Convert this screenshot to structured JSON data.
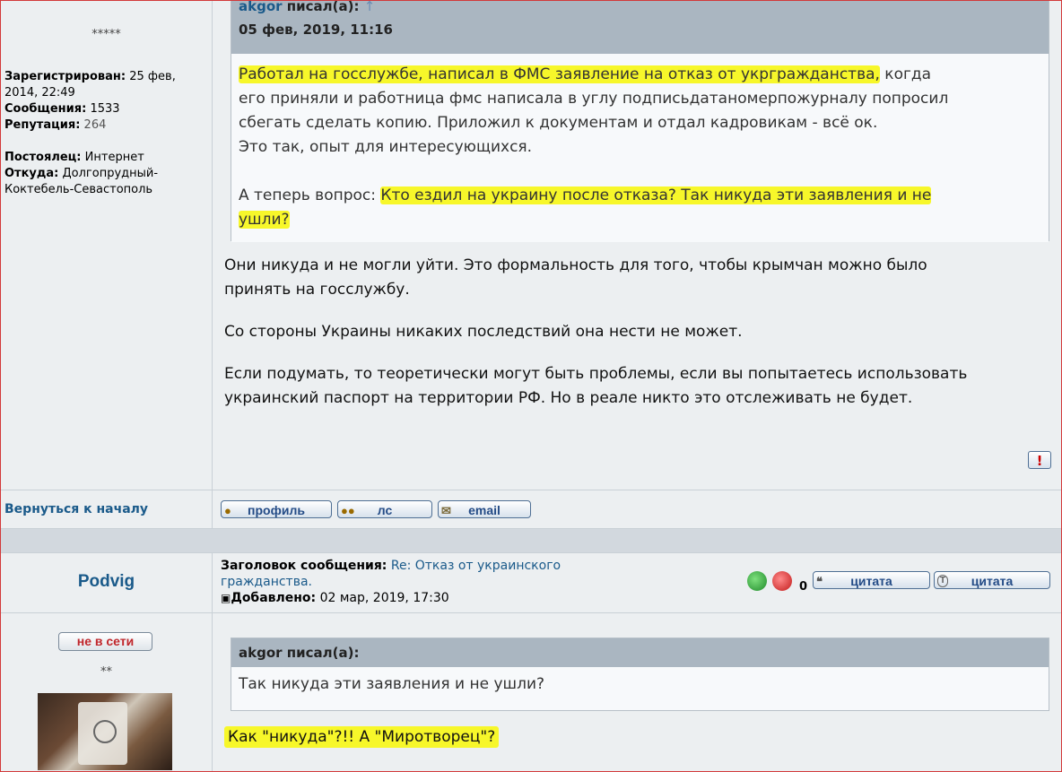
{
  "post1": {
    "rank_stars": "*****",
    "registered_label": "Зарегистрирован:",
    "registered_value": "25 фев, 2014, 22:49",
    "messages_label": "Сообщения:",
    "messages_value": "1533",
    "reputation_label": "Репутация:",
    "reputation_value": "264",
    "resident_label": "Постоялец:",
    "resident_value": "Интернет",
    "from_label": "Откуда:",
    "from_value": "Долгопрудный-Коктебель-Севастополь",
    "quote": {
      "author": "akgor",
      "wrote": "писал(а):",
      "date": "05 фев, 2019, 11:16",
      "line1_hl": "Работал на госслужбе, написал в ФМС заявление на отказ от укргражданства,",
      "line1_rest": " когда",
      "line2": "его приняли и работница фмс написала в углу подписьдатаномерпожурналу попросил",
      "line3": "сбегать сделать копию. Приложил к документам и отдал кадровикам - всё ок.",
      "line4": "Это так, опыт для интересующихся.",
      "line5_start": "А теперь вопрос: ",
      "line5_hl": "Кто ездил на украину после отказа? Так никуда эти заявления и не",
      "line6_hl": "ушли?"
    },
    "reply_p1_l1": "Они никуда и не могли уйти. Это формальность для того, чтобы крымчан можно было",
    "reply_p1_l2": "принять на госслужбу.",
    "reply_p2": "Со стороны Украины никаких последствий она нести не может.",
    "reply_p3_l1": "Если подумать, то теоретически могут быть проблемы, если вы попытаетесь использовать",
    "reply_p3_l2": "украинский паспорт на территории РФ. Но в реале никто это отслеживать не будет.",
    "report_icon": "!",
    "back_to_top": "Вернуться к началу",
    "buttons": {
      "profile": "профиль",
      "pm": "лс",
      "email": "email"
    }
  },
  "post2": {
    "username": "Podvig",
    "subject_label": "Заголовок сообщения:",
    "subject_value_l1": "Re: Отказ от украинского",
    "subject_value_l2": "гражданства.",
    "added_label": "Добавлено:",
    "added_value": "02 мар, 2019, 17:30",
    "vote_count": "0",
    "quote_btn_1": "цитата",
    "quote_btn_2": "цитата",
    "quote_btn_2_badge": "T",
    "status_badge": "не в сети",
    "rank_stars": "**",
    "quote": {
      "author": "akgor",
      "wrote": "писал(а):",
      "text": "Так никуда эти заявления и не ушли?"
    },
    "reply_hl": "Как \"никуда\"?!! А \"Миротворец\"?"
  },
  "colors": {
    "link": "#1a5a8a",
    "highlight": "#f7f72a",
    "quote_header": "#aab6c1",
    "frame_border": "#d23a3a"
  }
}
